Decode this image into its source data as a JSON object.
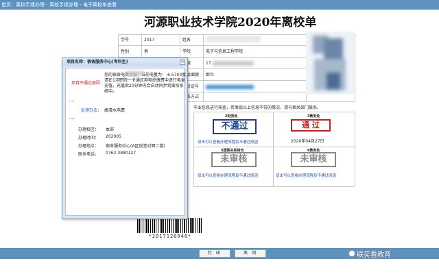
{
  "breadcrumb": "首页：离校手续办理 - 离校手续办理 - 电子离校单查看",
  "page_title": "河源职业技术学院2020年离校单",
  "info": {
    "rows": [
      {
        "l1": "学号",
        "v1": "2017",
        "l2": "姓名",
        "v2": ""
      },
      {
        "l1": "性别",
        "v1": "男",
        "l2": "学院",
        "v2": "电子与信息工程学院"
      },
      {
        "l1": "专业",
        "v1": "",
        "l2": "班级",
        "v2": "17"
      },
      {
        "l1": "",
        "v1": "",
        "l2": "政治面貌",
        "v2": "群众"
      },
      {
        "l1": "",
        "v1": "",
        "l2": "身份证号",
        "v2": ""
      },
      {
        "l1": "",
        "v1": "",
        "l2": "联系方式",
        "v2": ""
      }
    ]
  },
  "notice_text": "毕业信息进行核查，若发现以上信息不符的情况，请与相关部门联系。",
  "status": [
    {
      "title": "2财务处",
      "stamp": "不通过",
      "link": "双击可以查看办理流程及不通过原因"
    },
    {
      "title": "3教务处",
      "stamp": "通  过",
      "date": "2020年04月27日"
    },
    {
      "title": "5团委关系转出",
      "stamp": "未审核",
      "link": "双击可以查看办理流程及不通过原因"
    },
    {
      "title": "6教务处",
      "stamp": "未审核",
      "link": "双击可以查看办理流程及不通过原因"
    }
  ],
  "barcode_number": "*2017120046*",
  "buttons": {
    "print": "打 印",
    "close": "关 闭"
  },
  "watermark": "联奕看教育",
  "popup": {
    "title": "项目名称：宿舍服务中心(专科生)",
    "close_glyph": "×",
    "reason_label": "项目不通过原因：",
    "reason_lines": [
      "您的宿舍电费余额：当前电量为：-6.5700度，",
      "请在1河职院一卡通应用电控缴费中进行电量",
      "充值，充值后20分钟内会自动同步到离校系",
      "统中。"
    ],
    "sep1": "----",
    "method_label": "处理办法：",
    "method_value": "缴清水电费",
    "sep2": "----",
    "fields": [
      {
        "label": "办理校区：",
        "value": "本部"
      },
      {
        "label": "办理时间：",
        "value": "202005"
      },
      {
        "label": "办理地点：",
        "value": "宿舍服务中心(A区饭堂对面二楼)"
      },
      {
        "label": "联系电话：",
        "value": "0762-3880127"
      }
    ]
  },
  "colors": {
    "accent": "#5f91bf",
    "fail": "#1f3d8f",
    "pass": "#d11a1a",
    "pending": "#888888",
    "reason": "#d11a1a",
    "method": "#1f5fbf"
  }
}
